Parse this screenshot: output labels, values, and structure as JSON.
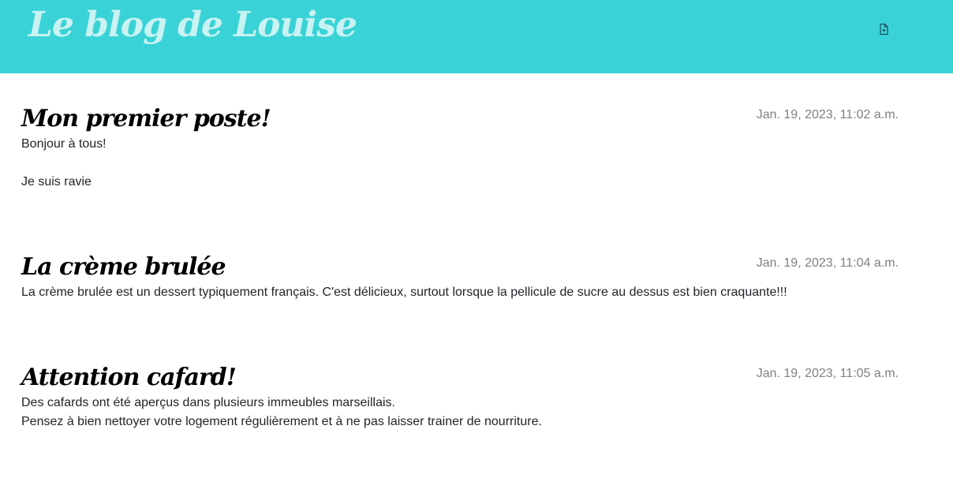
{
  "header": {
    "title": "Le blog de Louise"
  },
  "posts": [
    {
      "title": "Mon premier poste!",
      "date": "Jan. 19, 2023, 11:02 a.m.",
      "body": "Bonjour à tous!\n\nJe suis ravie"
    },
    {
      "title": "La crème brulée",
      "date": "Jan. 19, 2023, 11:04 a.m.",
      "body": "La crème brulée est un dessert typiquement français. C'est délicieux, surtout lorsque la pellicule de sucre au dessus est bien craquante!!!"
    },
    {
      "title": "Attention cafard!",
      "date": "Jan. 19, 2023, 11:05 a.m.",
      "body": "Des cafards ont été aperçus dans plusieurs immeubles marseillais.\nPensez à bien nettoyer votre logement régulièrement et à ne pas laisser trainer de nourriture."
    }
  ],
  "icons": {
    "new_post": "file-plus-icon"
  },
  "colors": {
    "header_bg": "#39d3d7",
    "title_color": "#c9f2f2",
    "date_color": "#808080"
  }
}
